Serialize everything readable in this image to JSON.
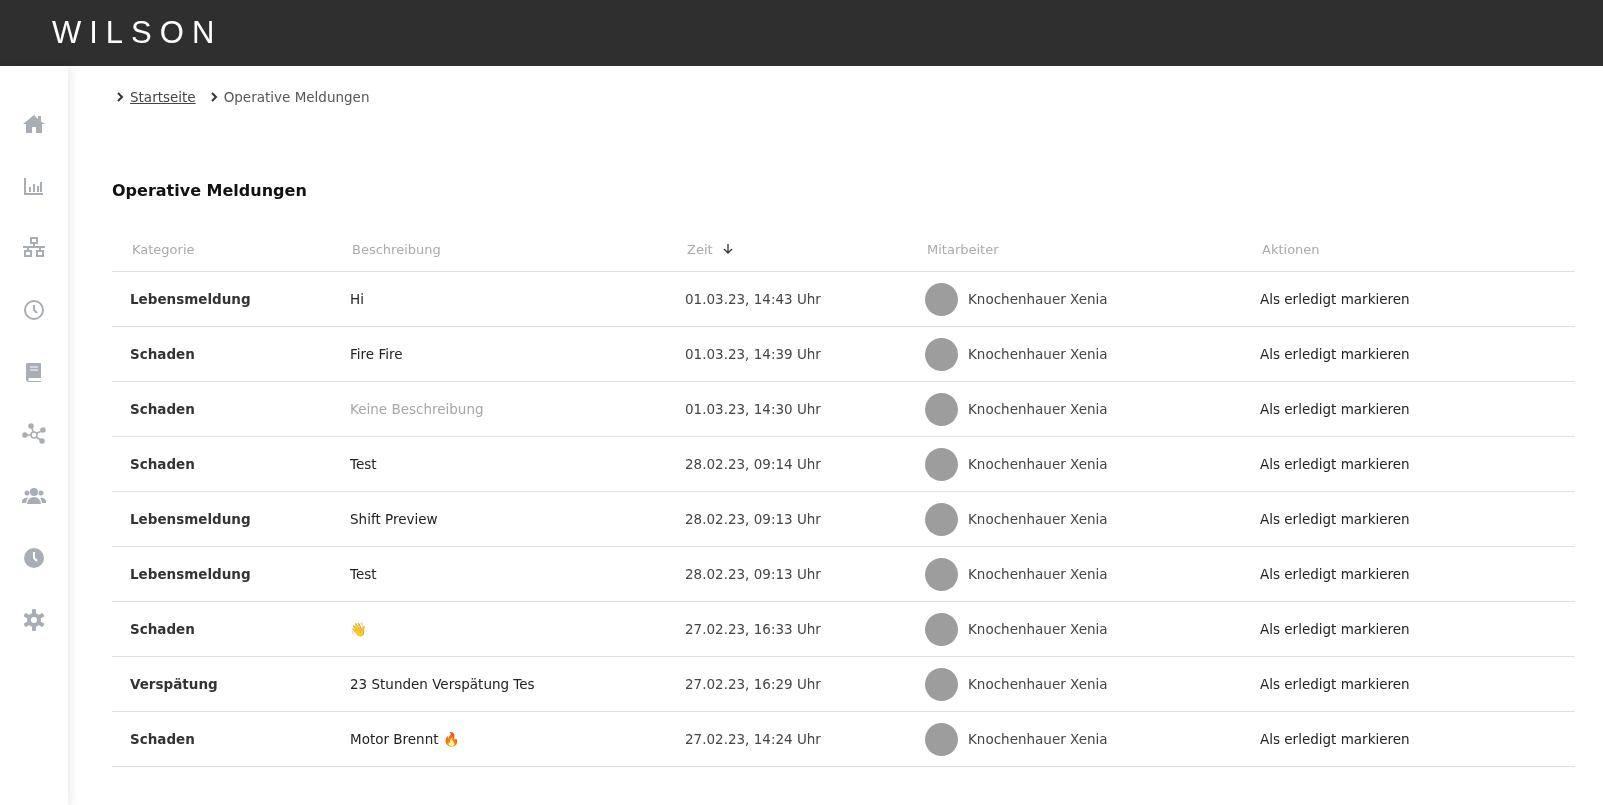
{
  "header": {
    "logo": "WILSON"
  },
  "breadcrumb": [
    {
      "label": "Startseite",
      "link": true
    },
    {
      "label": "Operative Meldungen",
      "link": false
    }
  ],
  "title": "Operative Meldungen",
  "table": {
    "columns": [
      {
        "label": "Kategorie",
        "sorted": false
      },
      {
        "label": "Beschreibung",
        "sorted": false
      },
      {
        "label": "Zeit",
        "sorted": true
      },
      {
        "label": "Mitarbeiter",
        "sorted": false
      },
      {
        "label": "Aktionen",
        "sorted": false
      }
    ],
    "rows": [
      {
        "category": "Lebensmeldung",
        "description": "Hi",
        "empty": false,
        "time": "01.03.23, 14:43 Uhr",
        "employee": "Knochenhauer Xenia",
        "action": "Als erledigt markieren"
      },
      {
        "category": "Schaden",
        "description": "Fire Fire",
        "empty": false,
        "time": "01.03.23, 14:39 Uhr",
        "employee": "Knochenhauer Xenia",
        "action": "Als erledigt markieren"
      },
      {
        "category": "Schaden",
        "description": "Keine Beschreibung",
        "empty": true,
        "time": "01.03.23, 14:30 Uhr",
        "employee": "Knochenhauer Xenia",
        "action": "Als erledigt markieren"
      },
      {
        "category": "Schaden",
        "description": "Test",
        "empty": false,
        "time": "28.02.23, 09:14 Uhr",
        "employee": "Knochenhauer Xenia",
        "action": "Als erledigt markieren"
      },
      {
        "category": "Lebensmeldung",
        "description": "Shift Preview",
        "empty": false,
        "time": "28.02.23, 09:13 Uhr",
        "employee": "Knochenhauer Xenia",
        "action": "Als erledigt markieren"
      },
      {
        "category": "Lebensmeldung",
        "description": "Test",
        "empty": false,
        "time": "28.02.23, 09:13 Uhr",
        "employee": "Knochenhauer Xenia",
        "action": "Als erledigt markieren"
      },
      {
        "category": "Schaden",
        "description": "👋",
        "empty": false,
        "time": "27.02.23, 16:33 Uhr",
        "employee": "Knochenhauer Xenia",
        "action": "Als erledigt markieren"
      },
      {
        "category": "Verspätung",
        "description": "23 Stunden Verspätung Tes",
        "empty": false,
        "time": "27.02.23, 16:29 Uhr",
        "employee": "Knochenhauer Xenia",
        "action": "Als erledigt markieren"
      },
      {
        "category": "Schaden",
        "description": "Motor Brennt 🔥",
        "empty": false,
        "time": "27.02.23, 14:24 Uhr",
        "employee": "Knochenhauer Xenia",
        "action": "Als erledigt markieren"
      }
    ]
  }
}
